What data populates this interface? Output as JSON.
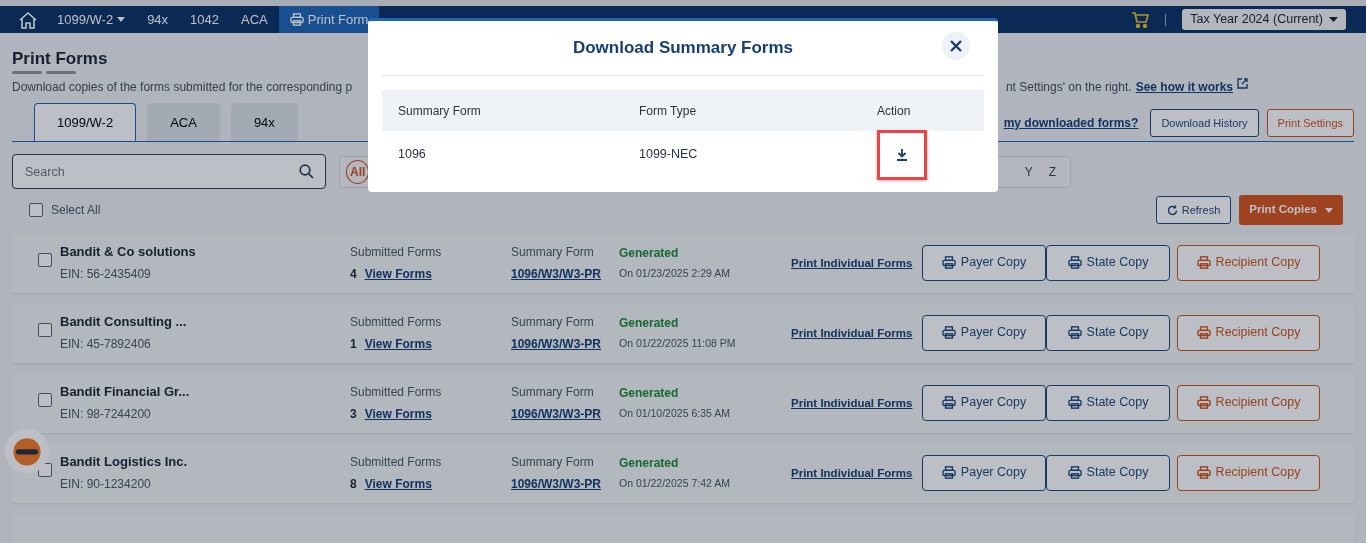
{
  "navbar": {
    "items": [
      {
        "label": "1099/W-2",
        "dropdown": true,
        "selected": false
      },
      {
        "label": "94x",
        "dropdown": false,
        "selected": false
      },
      {
        "label": "1042",
        "dropdown": false,
        "selected": false
      },
      {
        "label": "ACA",
        "dropdown": false,
        "selected": false
      },
      {
        "label": "Print Form",
        "dropdown": false,
        "selected": true
      }
    ],
    "tax_year": "Tax Year 2024 (Current)"
  },
  "page": {
    "title": "Print Forms",
    "description": "Download copies of the forms submitted for the corresponding p",
    "description_right": "nt Settings' on the right.",
    "help_link": "See how it works",
    "tabs": [
      {
        "label": "1099/W-2",
        "selected": true
      },
      {
        "label": "ACA",
        "selected": false
      },
      {
        "label": "94x",
        "selected": false
      }
    ],
    "downloaded_link": "my downloaded forms?",
    "buttons": [
      "Download History",
      "Print Settings"
    ],
    "search": {
      "placeholder": "Search"
    },
    "letters": [
      {
        "label": "All",
        "selected": true
      },
      {
        "label": "Y",
        "selected": false
      },
      {
        "label": "Z",
        "selected": false
      }
    ],
    "select_all": {
      "label": "Select All",
      "checked": false
    },
    "refresh": "Refresh",
    "print_copies": "Print Copies"
  },
  "rows": [
    {
      "name": "Bandit & Co solutions",
      "ein": "EIN: 56-2435409",
      "submitted_label": "Submitted Forms",
      "count": "4",
      "view_link": "View Forms",
      "summary_label": "Summary Form",
      "summary_link": "1096/W3/W3-PR",
      "status": "Generated",
      "date": "On 01/23/2025 2:29 AM",
      "print_link": "Print Individual Forms",
      "actions": [
        "Payer Copy",
        "State Copy",
        "Recipient Copy"
      ],
      "checked": false
    },
    {
      "name": "Bandit Consulting ...",
      "ein": "EIN: 45-7892406",
      "submitted_label": "Submitted Forms",
      "count": "1",
      "view_link": "View Forms",
      "summary_label": "Summary Form",
      "summary_link": "1096/W3/W3-PR",
      "status": "Generated",
      "date": "On 01/22/2025 11:08 PM",
      "print_link": "Print Individual Forms",
      "actions": [
        "Payer Copy",
        "State Copy",
        "Recipient Copy"
      ],
      "checked": false
    },
    {
      "name": "Bandit Financial Gr...",
      "ein": "EIN: 98-7244200",
      "submitted_label": "Submitted Forms",
      "count": "3",
      "view_link": "View Forms",
      "summary_label": "Summary Form",
      "summary_link": "1096/W3/W3-PR",
      "status": "Generated",
      "date": "On 01/10/2025 6:35 AM",
      "print_link": "Print Individual Forms",
      "actions": [
        "Payer Copy",
        "State Copy",
        "Recipient Copy"
      ],
      "checked": false
    },
    {
      "name": "Bandit Logistics Inc.",
      "ein": "EIN: 90-1234200",
      "submitted_label": "Submitted Forms",
      "count": "8",
      "view_link": "View Forms",
      "summary_label": "Summary Form",
      "summary_link": "1096/W3/W3-PR",
      "status": "Generated",
      "date": "On 01/22/2025 7:42 AM",
      "print_link": "Print Individual Forms",
      "actions": [
        "Payer Copy",
        "State Copy",
        "Recipient Copy"
      ],
      "checked": false
    }
  ],
  "modal": {
    "title": "Download Summary Forms",
    "columns": [
      "Summary Form",
      "Form Type",
      "Action"
    ],
    "rows": [
      {
        "summary_form": "1096",
        "form_type": "1099-NEC",
        "highlighted": true
      }
    ]
  }
}
